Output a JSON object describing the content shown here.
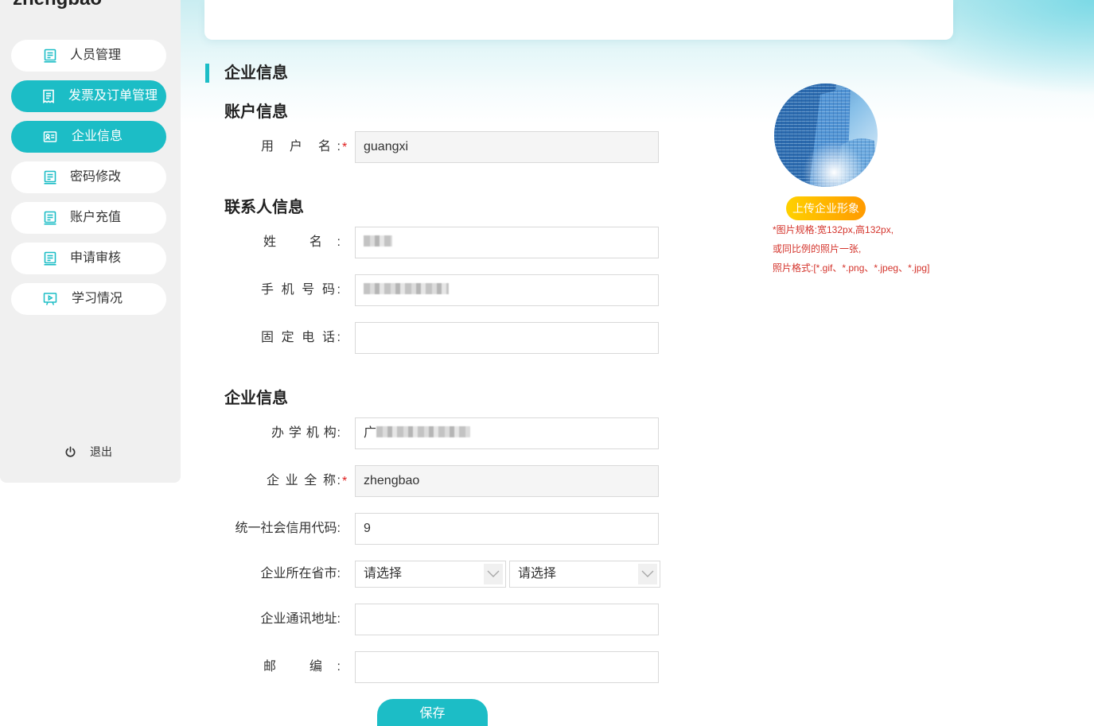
{
  "colors": {
    "accent": "#1cbdc6",
    "required": "#e02020",
    "note": "#d4332b",
    "upload_start": "#ffd100",
    "upload_end": "#ff9a00"
  },
  "sidebar": {
    "brand": "zhengbao",
    "items": [
      {
        "label": "人员管理",
        "icon": "document-icon",
        "active": false
      },
      {
        "label": "发票及订单管理",
        "icon": "receipt-icon",
        "active": true
      },
      {
        "label": "企业信息",
        "icon": "id-card-icon",
        "active": true
      },
      {
        "label": "密码修改",
        "icon": "document-icon",
        "active": false
      },
      {
        "label": "账户充值",
        "icon": "document-icon",
        "active": false
      },
      {
        "label": "申请审核",
        "icon": "document-icon",
        "active": false
      },
      {
        "label": "学习情况",
        "icon": "presentation-icon",
        "active": false
      }
    ],
    "logout": {
      "label": "退出",
      "icon": "power-icon"
    }
  },
  "page": {
    "title": "企业信息"
  },
  "account": {
    "heading": "账户信息",
    "username": {
      "label": "用 户 名:",
      "required_mark": "*",
      "value": "guangxi"
    }
  },
  "contact": {
    "heading": "联系人信息",
    "name": {
      "label": "姓 名:",
      "value": "",
      "masked": true
    },
    "mobile": {
      "label": "手 机 号 码:",
      "value": "",
      "masked": true
    },
    "landline": {
      "label": "固 定 电 话:",
      "value": ""
    }
  },
  "company": {
    "heading": "企业信息",
    "institution": {
      "label": "办 学 机 构:",
      "value": "广",
      "masked": true
    },
    "full_name": {
      "label": "企 业 全 称:",
      "required_mark": "*",
      "value": "zhengbao"
    },
    "credit_code": {
      "label": "统一社会信用代码:",
      "value": "9"
    },
    "province_city": {
      "label": "企业所在省市:",
      "province": "请选择",
      "city": "请选择"
    },
    "address": {
      "label": "企业通讯地址:",
      "value": ""
    },
    "postcode": {
      "label": "邮 编:",
      "value": ""
    }
  },
  "actions": {
    "save": "保存"
  },
  "image_panel": {
    "upload_label": "上传企业形象",
    "notes": [
      "*图片规格:宽132px,高132px,",
      "或同比例的照片一张,",
      "照片格式:[*.gif、*.png、*.jpeg、*.jpg]"
    ]
  }
}
